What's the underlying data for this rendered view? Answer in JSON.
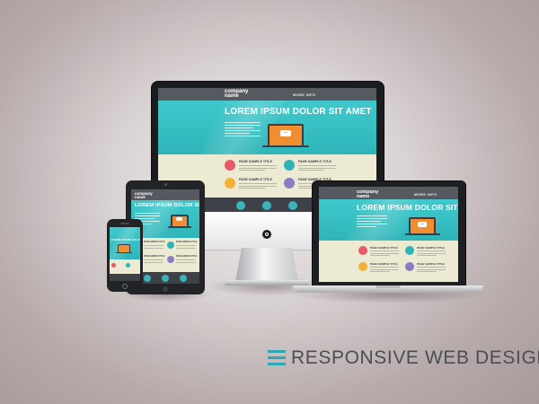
{
  "site": {
    "logo_line1": "company",
    "logo_line2": "name",
    "nav_text": "MORE INFO",
    "hero_title": "LOREM IPSUM DOLOR SIT AMET",
    "bubble_text": "...",
    "features": [
      {
        "title": "PAGE SAMPLE TITLE",
        "icon": "photo-icon",
        "color": "#e85a6a"
      },
      {
        "title": "PAGE SAMPLE TITLE",
        "icon": "search-icon",
        "color": "#2fb3b7"
      },
      {
        "title": "PAGE SAMPLE TITLE",
        "icon": "lightbulb-icon",
        "color": "#f3b13a"
      },
      {
        "title": "PAGE SAMPLE TITLE",
        "icon": "pencil-icon",
        "color": "#8e7bc4"
      }
    ]
  },
  "heading": "RESPONSIVE WEB DESIGN",
  "colors": {
    "accent": "#2aa9b3",
    "hero": "#3fc9cc",
    "content_bg": "#ecead2",
    "device_frame": "#1b1c1f",
    "orange": "#f08e32"
  }
}
